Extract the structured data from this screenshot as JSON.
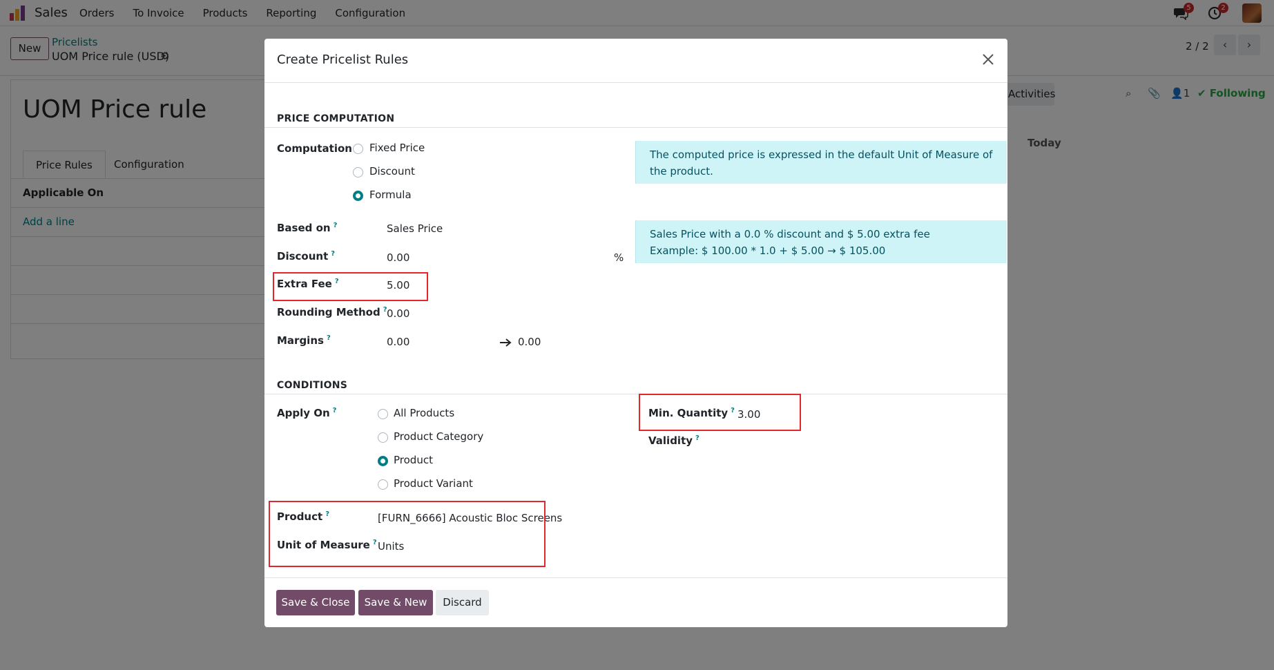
{
  "navbar": {
    "app_name": "Sales",
    "menu": [
      "Orders",
      "To Invoice",
      "Products",
      "Reporting",
      "Configuration"
    ],
    "messages_count": "5",
    "activities_count": "2"
  },
  "control_panel": {
    "new_label": "New",
    "breadcrumb_parent": "Pricelists",
    "breadcrumb_current": "UOM Price rule (USD)",
    "pager": "2 / 2"
  },
  "form": {
    "title": "UOM Price rule",
    "tabs": [
      "Price Rules",
      "Configuration"
    ],
    "applicable_on": "Applicable On",
    "add_line": "Add a line"
  },
  "chatter": {
    "activities": "Activities",
    "followers": "1",
    "following": "Following",
    "today": "Today"
  },
  "modal": {
    "title": "Create Pricelist Rules",
    "price_computation": {
      "section": "PRICE COMPUTATION",
      "computation_label": "Computation",
      "options": [
        "Fixed Price",
        "Discount",
        "Formula"
      ],
      "selected": "Formula",
      "uom_note": "The computed price is expressed in the default Unit of Measure of the product.",
      "based_on_label": "Based on",
      "based_on": "Sales Price",
      "discount_label": "Discount",
      "discount": "0.00",
      "percent": "%",
      "extra_fee_label": "Extra Fee",
      "extra_fee": "5.00",
      "rounding_label": "Rounding Method",
      "rounding": "0.00",
      "margins_label": "Margins",
      "margin_min": "0.00",
      "margin_max": "0.00",
      "formula_line1": "Sales Price with a 0.0 % discount and $ 5.00 extra fee",
      "formula_line2": "Example: $ 100.00 * 1.0 + $ 5.00 → $ 105.00"
    },
    "conditions": {
      "section": "CONDITIONS",
      "apply_on_label": "Apply On",
      "options": [
        "All Products",
        "Product Category",
        "Product",
        "Product Variant"
      ],
      "selected": "Product",
      "product_label": "Product",
      "product": "[FURN_6666] Acoustic Bloc Screens",
      "uom_label": "Unit of Measure",
      "uom": "Units",
      "min_qty_label": "Min. Quantity",
      "min_qty": "3.00",
      "validity_label": "Validity"
    },
    "footer": {
      "save_close": "Save & Close",
      "save_new": "Save & New",
      "discard": "Discard"
    }
  },
  "colors": {
    "primary": "#714b67",
    "link": "#017e84",
    "highlight": "#e3262b",
    "info_bg": "#cff4f7"
  }
}
